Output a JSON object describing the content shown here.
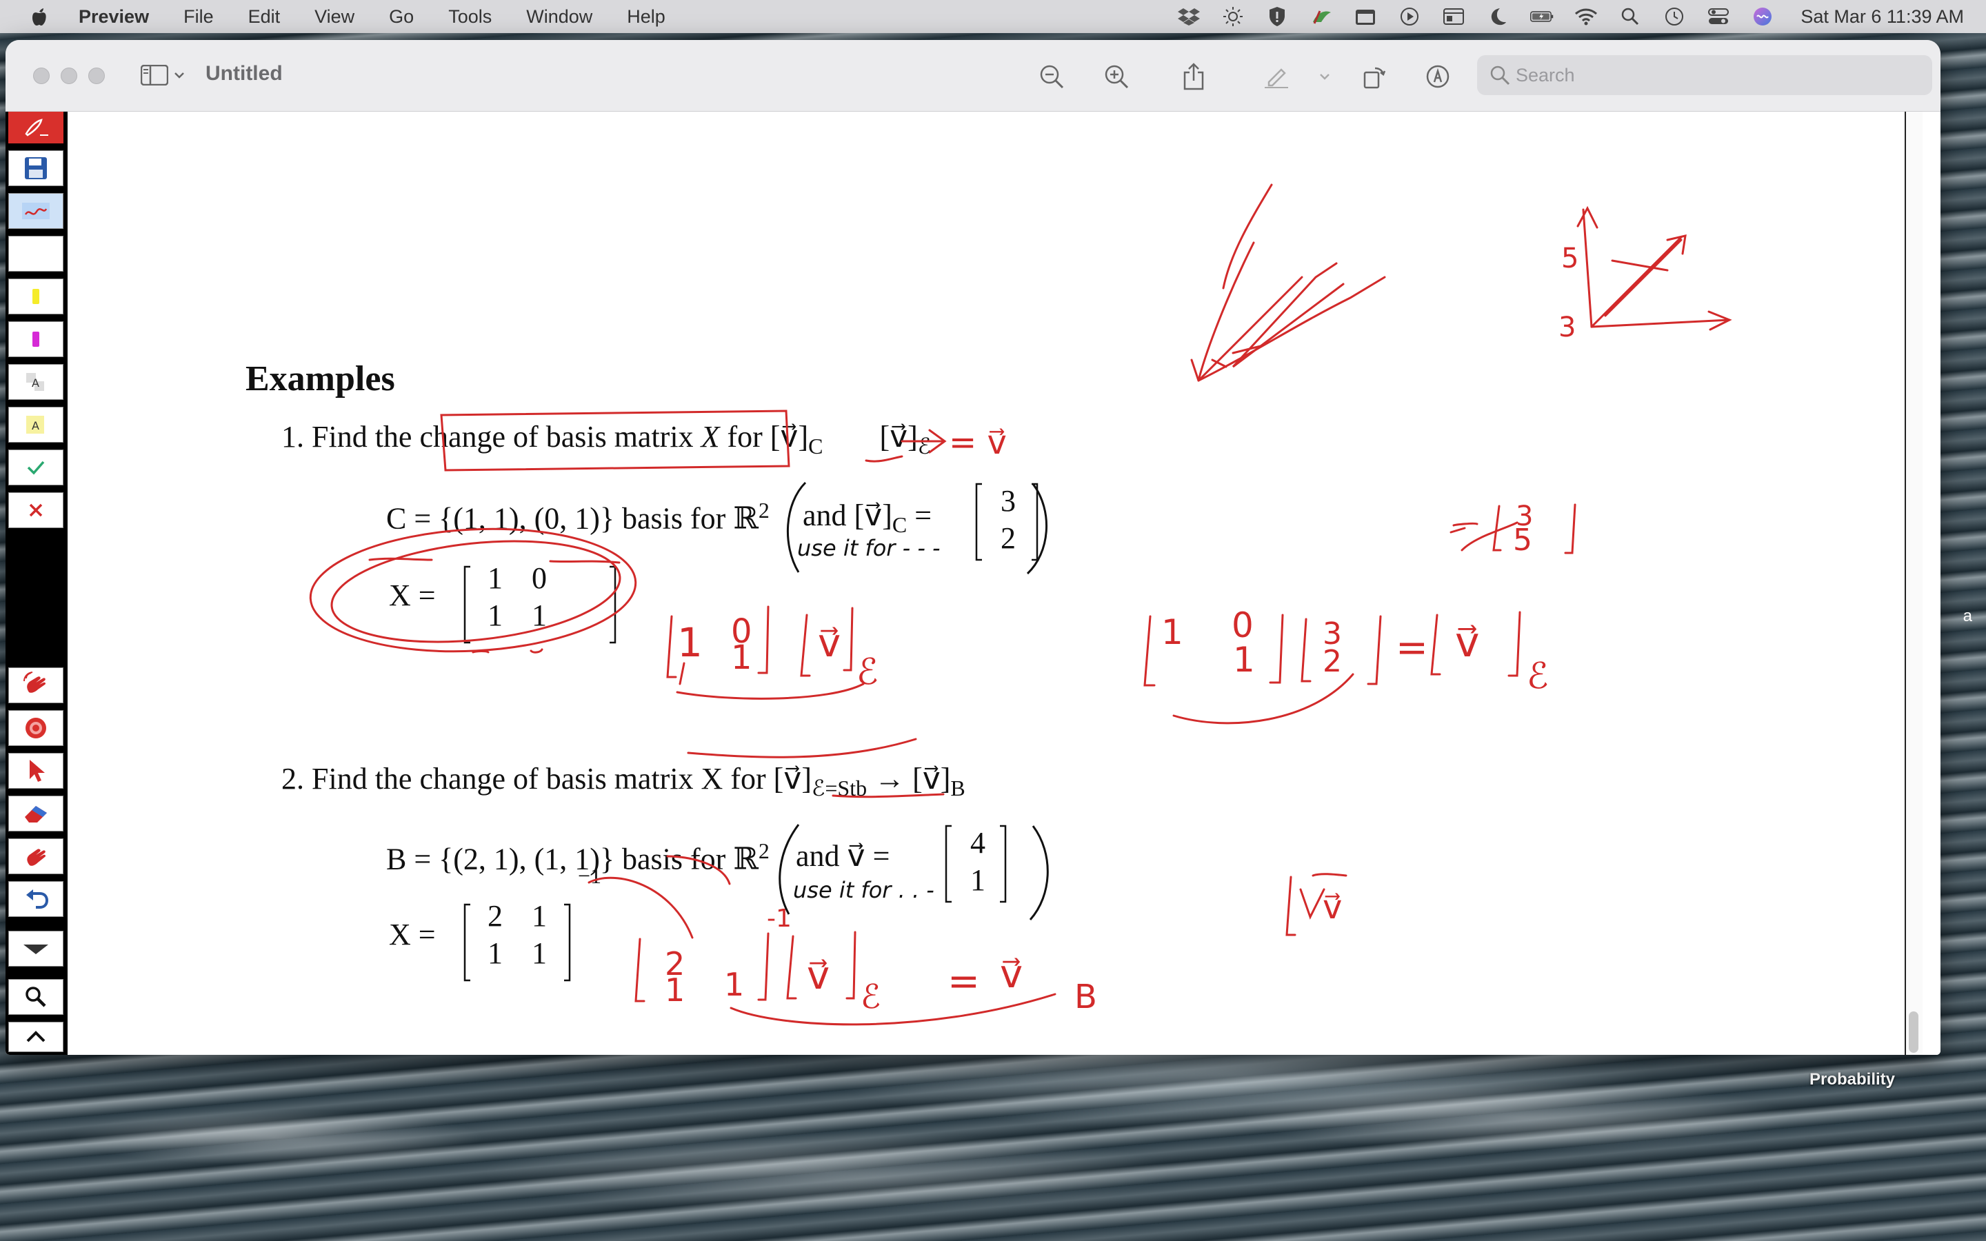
{
  "menubar": {
    "app_name": "Preview",
    "items": [
      "File",
      "Edit",
      "View",
      "Go",
      "Tools",
      "Window",
      "Help"
    ],
    "clock": "Sat Mar 6  11:39 AM"
  },
  "window": {
    "title": "Untitled",
    "search_placeholder": "Search"
  },
  "desktop": {
    "label": "Probability",
    "edge_text": "a"
  },
  "document": {
    "heading": "Examples",
    "problem1": {
      "number": "1.",
      "text_a": "Find the",
      "boxed": "change of basis matrix",
      "var": "X",
      "text_b": "for",
      "from": "[v⃗]",
      "from_sub": "C",
      "to": "[v⃗]",
      "to_sub": "ℰ",
      "basis_line": "C = {(1, 1), (0, 1)} basis for ℝ",
      "basis_sup": "2",
      "and_text": "and [v⃗]",
      "and_sub": "C",
      "and_eq": "=",
      "vector": [
        "3",
        "2"
      ],
      "x_label": "X =",
      "matrix": [
        [
          "1",
          "0"
        ],
        [
          "1",
          "1"
        ]
      ]
    },
    "problem2": {
      "number": "2.",
      "text": "Find the change of basis matrix X for [v⃗]",
      "from_sub": "ℰ=Stb",
      "arrow": "→ [v⃗]",
      "to_sub": "B",
      "basis_line": "B = {(2, 1), (1, 1)} basis for ℝ",
      "basis_sup": "2",
      "and_text": "and v⃗ =",
      "vector": [
        "4",
        "1"
      ],
      "x_label": "X =",
      "matrix": [
        [
          "2",
          "1"
        ],
        [
          "1",
          "1"
        ]
      ],
      "exponent": "−1"
    }
  },
  "handwriting": {
    "eq1": "= v⃗",
    "note1": "use it for - - -",
    "note2": "use it for . . -",
    "col_top": "3",
    "col_bottom": "5",
    "tick3": "3",
    "tick5": "5",
    "sub_E": "ℰ",
    "sub_B": "B",
    "neg1": "-1",
    "v": "v⃗",
    "eq": "=",
    "eq_long": "=",
    "m_1": "1",
    "m_0": "0",
    "m_2": "2"
  }
}
